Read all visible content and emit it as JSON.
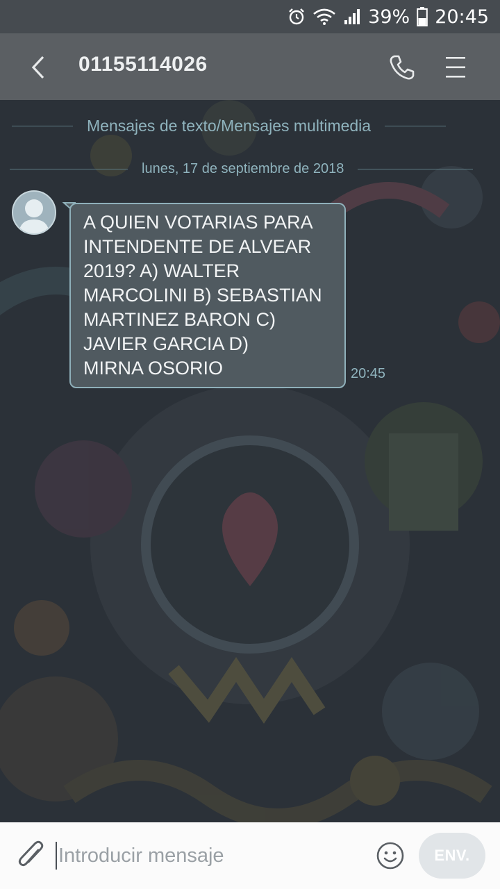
{
  "status_bar": {
    "battery": "39%",
    "time": "20:45",
    "icons": [
      "alarm-icon",
      "wifi-icon",
      "signal-icon",
      "battery-icon"
    ]
  },
  "header": {
    "contact": "01155114026",
    "icons": [
      "back-arrow-icon",
      "phone-icon",
      "menu-icon"
    ]
  },
  "conversation": {
    "type_label": "Mensajes de texto/Mensajes multimedia",
    "date_label": "lunes, 17 de septiembre de 2018",
    "messages": [
      {
        "lines": [
          "A  QUIEN VOTARIAS PARA",
          "INTENDENTE DE    ALVEAR",
          "2019? A)  WALTER",
          "MARCOLINI B) SEBASTIAN",
          "MARTINEZ    BARON     C)",
          "JAVIER GARCIA     D)",
          "MIRNA     OSORIO"
        ],
        "time": "20:45"
      }
    ]
  },
  "composer": {
    "placeholder": "Introducir mensaje",
    "send_label": "ENV.",
    "icons": [
      "paperclip-icon",
      "emoji-icon"
    ]
  },
  "colors": {
    "status_bar": "#464b50",
    "header": "#5b5f63",
    "bubble": "#505a60",
    "accent": "#8fb3bd"
  }
}
